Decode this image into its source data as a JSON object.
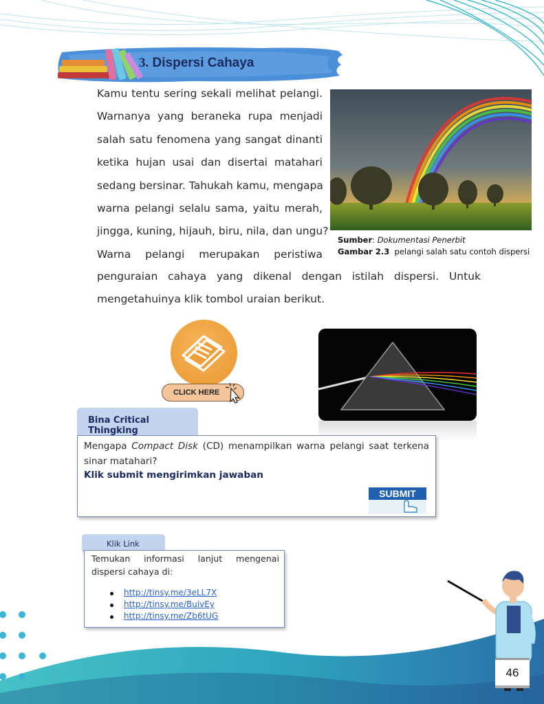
{
  "section": {
    "number": "3.",
    "title": "Dispersi Cahaya"
  },
  "paragraph1_lines": [
    "Kamu tentu sering sekali melihat pelangi.",
    "Warnanya yang beraneka rupa menjadi",
    "salah satu fenomena yang sangat dinanti",
    "ketika hujan usai dan disertai matahari",
    "sedang bersinar.  Tahukah kamu, mengapa",
    "warna pelangi selalu sama, yaitu merah,",
    "jingga, kuning, hijauh, biru, nila, dan ungu?",
    "Warna pelangi merupakan peristiwa"
  ],
  "paragraph2_lines": [
    "penguraian cahaya yang dikenal dengan istilah dispersi. Untuk",
    "mengetahuinya klik tombol uraian berikut."
  ],
  "figure": {
    "source_label": "Sumber",
    "source_sep": ": ",
    "source_value": "Dokumentasi Penerbit",
    "caption_label": "Gambar 2.3",
    "caption_text": "pelangi salah satu contoh dispersi"
  },
  "click_button": {
    "label": "CLICK HERE"
  },
  "critical": {
    "tab_label": "Bina Critical Thingking",
    "question_pre": "Mengapa ",
    "question_italic": "Compact Disk",
    "question_post": " (CD) menampilkan warna pelangi saat terkena sinar matahari?",
    "instruction": "Klik submit mengirimkan jawaban",
    "submit_label": "SUBMIT"
  },
  "link_box": {
    "tab_label": "Klik Link",
    "text": "Temukan informasi lanjut mengenai dispersi cahaya di:",
    "links": [
      "http://tinsy.me/3eLL7X",
      "http://tinsy.me/BuivEy",
      "http://tinsy.me/Zb6tUG"
    ]
  },
  "page_number": "46",
  "colors": {
    "title_navy": "#1b2a5e",
    "tab_blue": "#c3d4ee",
    "brush_blue": "#4a8fd8",
    "teal_wave": "#46c2c6",
    "accent_orange": "#eda03a"
  }
}
